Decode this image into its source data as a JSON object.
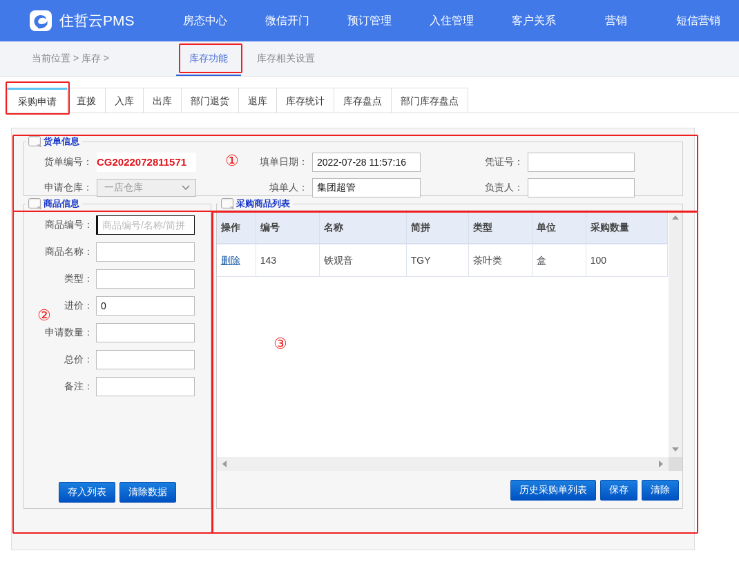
{
  "header": {
    "logo_text": "住哲云PMS",
    "nav": [
      {
        "label": "房态中心"
      },
      {
        "label": "微信开门"
      },
      {
        "label": "预订管理"
      },
      {
        "label": "入住管理"
      },
      {
        "label": "客户关系"
      },
      {
        "label": "营销"
      },
      {
        "label": "短信营销"
      }
    ]
  },
  "breadcrumb": "当前位置 > 库存 >",
  "section_tabs": [
    {
      "label": "库存功能",
      "selected": true
    },
    {
      "label": "库存相关设置",
      "selected": false
    }
  ],
  "function_tabs": [
    {
      "label": "采购申请",
      "selected": true
    },
    {
      "label": "直拨",
      "selected": false
    },
    {
      "label": "入库",
      "selected": false
    },
    {
      "label": "出库",
      "selected": false
    },
    {
      "label": "部门退货",
      "selected": false
    },
    {
      "label": "退库",
      "selected": false
    },
    {
      "label": "库存统计",
      "selected": false
    },
    {
      "label": "库存盘点",
      "selected": false
    },
    {
      "label": "部门库存盘点",
      "selected": false
    }
  ],
  "order_info": {
    "title": "货单信息",
    "fields": [
      {
        "label": "货单编号：",
        "kind": "code",
        "value": "CG2022072811571"
      },
      {
        "label": "填单日期：",
        "kind": "input",
        "value": "2022-07-28 11:57:16"
      },
      {
        "label": "凭证号：",
        "kind": "input"
      },
      {
        "label": "申请仓库：",
        "kind": "select",
        "value": "一店仓库",
        "disabled": true
      },
      {
        "label": "填单人：",
        "kind": "input",
        "value": "集团超管"
      },
      {
        "label": "负责人：",
        "kind": "input"
      }
    ]
  },
  "goods_info": {
    "title": "商品信息",
    "fields": [
      {
        "label": "商品编号：",
        "placeholder": "商品编号/名称/简拼",
        "focused": true
      },
      {
        "label": "商品名称：",
        "focused": false
      },
      {
        "label": "类型：",
        "focused": false
      },
      {
        "label": "进价：",
        "value": "0",
        "focused": false
      },
      {
        "label": "申请数量：",
        "focused": false
      },
      {
        "label": "总价：",
        "focused": false
      },
      {
        "label": "备注：",
        "focused": false
      }
    ],
    "buttons": [
      "存入列表",
      "清除数据"
    ]
  },
  "purchase_list": {
    "title": "采购商品列表",
    "columns": [
      {
        "label": "操作",
        "kind": "action"
      },
      {
        "label": "编号",
        "kind": "text"
      },
      {
        "label": "名称",
        "kind": "text"
      },
      {
        "label": "简拼",
        "kind": "text"
      },
      {
        "label": "类型",
        "kind": "text"
      },
      {
        "label": "单位",
        "kind": "text"
      },
      {
        "label": "采购数量",
        "kind": "text"
      }
    ],
    "rows": [
      {
        "cells": [
          "删除",
          "143",
          "铁观音",
          "TGY",
          "茶叶类",
          "盒",
          "100"
        ]
      }
    ],
    "buttons": [
      "历史采购单列表",
      "保存",
      "清除"
    ]
  },
  "annotations": [
    {
      "mark": "①"
    },
    {
      "mark": "②"
    },
    {
      "mark": "③"
    }
  ]
}
